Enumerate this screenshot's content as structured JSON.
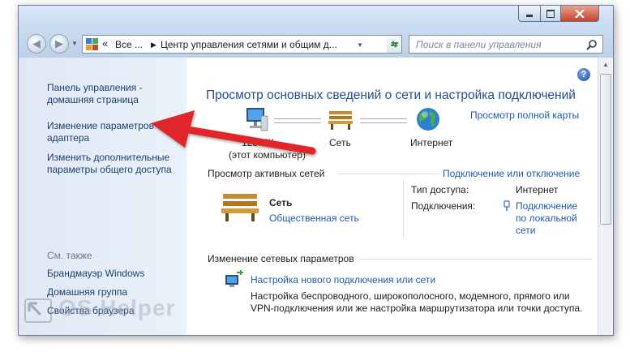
{
  "window": {
    "minimize_icon": "minimize-icon",
    "maximize_icon": "maximize-icon",
    "close_icon": "close-icon"
  },
  "navbar": {
    "address_prefix": "«",
    "crumb_1": "Все ...",
    "crumb_2": "Центр управления сетями и общим д...",
    "search_placeholder": "Поиск в панели управления"
  },
  "sidebar": {
    "home_link_line1": "Панель управления -",
    "home_link_line2": "домашняя страница",
    "adapter_line1": "Изменение параметров",
    "adapter_line2": "адаптера",
    "sharing_line1": "Изменить дополнительные",
    "sharing_line2": "параметры общего доступа",
    "see_also": "См. также",
    "see_also_items": [
      "Брандмауэр Windows",
      "Домашняя группа",
      "Свойства браузера"
    ]
  },
  "main": {
    "title": "Просмотр основных сведений о сети и настройка подключений",
    "full_map_link": "Просмотр полной карты",
    "map_nodes": {
      "computer_name": "123-ПК",
      "computer_sub": "(этот компьютер)",
      "network": "Сеть",
      "internet": "Интернет"
    },
    "active_networks": {
      "header": "Просмотр активных сетей",
      "connect_link": "Подключение или отключение",
      "network_name": "Сеть",
      "network_type": "Общественная сеть",
      "access_label": "Тип доступа:",
      "access_value": "Интернет",
      "connections_label": "Подключения:",
      "connection_line1": "Подключение",
      "connection_line2": "по локальной",
      "connection_line3": "сети"
    },
    "change_settings": {
      "header": "Изменение сетевых параметров",
      "new_connection_link": "Настройка нового подключения или сети",
      "desc_line1": "Настройка беспроводного, широкополосного, модемного, прямого или",
      "desc_line2": "VPN-подключения или же настройка маршрутизатора или точки доступа."
    },
    "help_label": "?"
  },
  "watermark": "OS Helper",
  "colors": {
    "title_blue": "#1f4f8f",
    "link_blue": "#1f5aa8",
    "arrow_red": "#e0262c"
  }
}
